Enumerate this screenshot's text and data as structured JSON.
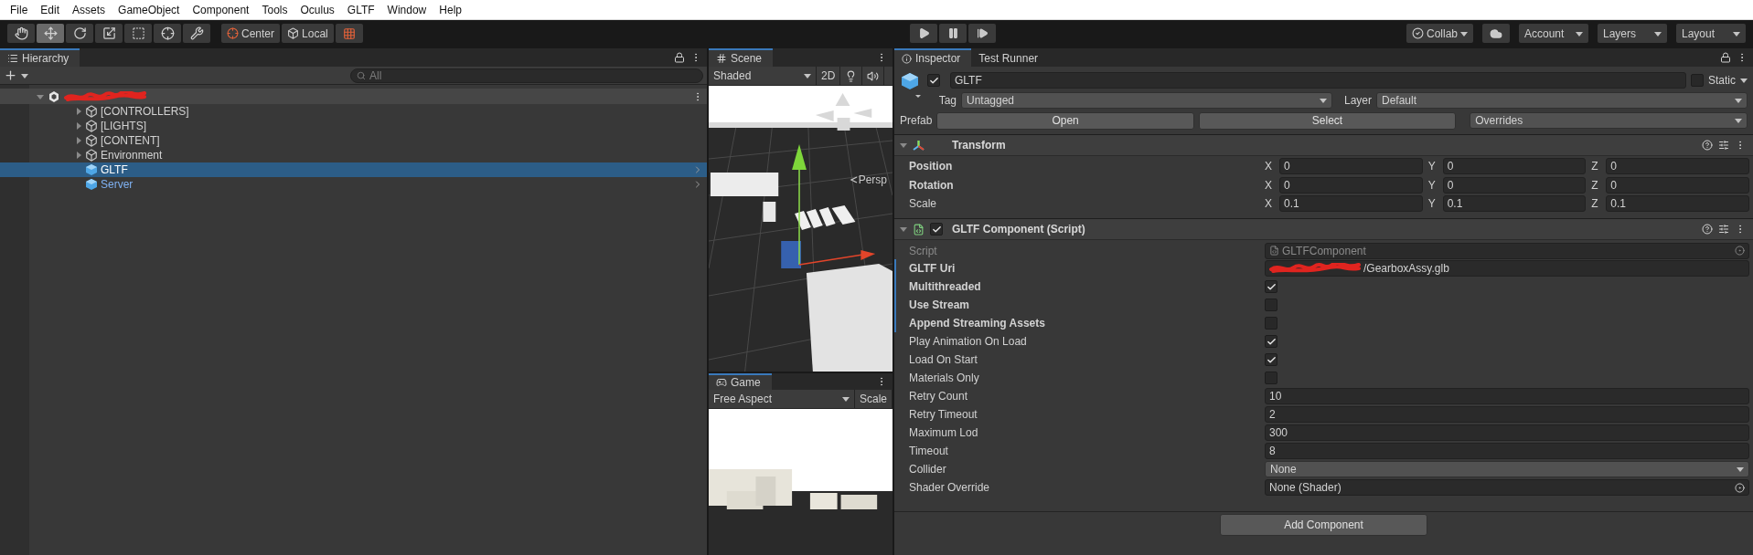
{
  "menu": [
    "File",
    "Edit",
    "Assets",
    "GameObject",
    "Component",
    "Tools",
    "Oculus",
    "GLTF",
    "Window",
    "Help"
  ],
  "toolbar": {
    "tools": [
      {
        "kind": "hand",
        "selected": false
      },
      {
        "kind": "move",
        "selected": true
      },
      {
        "kind": "rotate",
        "selected": false
      },
      {
        "kind": "scale",
        "selected": false
      },
      {
        "kind": "rect",
        "selected": false
      },
      {
        "kind": "transform",
        "selected": false
      },
      {
        "kind": "custom",
        "selected": false
      }
    ],
    "pivot": "Center",
    "space": "Local",
    "playback": [
      {
        "kind": "play"
      },
      {
        "kind": "pause"
      },
      {
        "kind": "step"
      }
    ],
    "collab": "Collab",
    "dropdowns": [
      "Account",
      "Layers",
      "Layout"
    ]
  },
  "hierarchy": {
    "title": "Hierarchy",
    "search_placeholder": "All",
    "scene_expanded": true,
    "items": [
      {
        "name": "[CONTROLLERS]",
        "kind": "object",
        "expandable": true,
        "selected": false
      },
      {
        "name": "[LIGHTS]",
        "kind": "object",
        "expandable": true,
        "selected": false
      },
      {
        "name": "[CONTENT]",
        "kind": "object",
        "expandable": true,
        "selected": false
      },
      {
        "name": "Environment",
        "kind": "object",
        "expandable": true,
        "selected": false
      },
      {
        "name": "GLTF",
        "kind": "prefab",
        "expandable": false,
        "selected": true
      },
      {
        "name": "Server",
        "kind": "prefab",
        "expandable": false,
        "selected": false
      }
    ]
  },
  "scene": {
    "title": "Scene",
    "shading": "Shaded",
    "mode_2d": "2D",
    "projection": "Persp"
  },
  "game": {
    "title": "Game",
    "aspect": "Free Aspect",
    "scale": "Scale"
  },
  "inspector": {
    "tabs": [
      {
        "label": "Inspector",
        "selected": true
      },
      {
        "label": "Test Runner",
        "selected": false
      }
    ],
    "object": {
      "name": "GLTF",
      "active": true,
      "static": false,
      "static_label": "Static",
      "tag_label": "Tag",
      "tag": "Untagged",
      "layer_label": "Layer",
      "layer": "Default",
      "prefab_label": "Prefab",
      "prefab_buttons": [
        "Open",
        "Select"
      ],
      "overrides": "Overrides"
    },
    "transform": {
      "title": "Transform",
      "expanded": true,
      "rows": [
        {
          "label": "Position",
          "overridden": true,
          "values": [
            {
              "axis": "X",
              "value": "0"
            },
            {
              "axis": "Y",
              "value": "0"
            },
            {
              "axis": "Z",
              "value": "0"
            }
          ]
        },
        {
          "label": "Rotation",
          "overridden": true,
          "values": [
            {
              "axis": "X",
              "value": "0"
            },
            {
              "axis": "Y",
              "value": "0"
            },
            {
              "axis": "Z",
              "value": "0"
            }
          ]
        },
        {
          "label": "Scale",
          "overridden": false,
          "values": [
            {
              "axis": "X",
              "value": "0.1"
            },
            {
              "axis": "Y",
              "value": "0.1"
            },
            {
              "axis": "Z",
              "value": "0.1"
            }
          ]
        }
      ]
    },
    "component": {
      "title": "GLTF Component (Script)",
      "enabled": true,
      "expanded": true,
      "fields": [
        {
          "kind": "script",
          "label": "Script",
          "value": "GLTFComponent",
          "overridden": false
        },
        {
          "kind": "uri",
          "label": "GLTF Uri",
          "value": "/GearboxAssy.glb",
          "overridden": true
        },
        {
          "kind": "toggle",
          "label": "Multithreaded",
          "checked": true,
          "overridden": true
        },
        {
          "kind": "toggle",
          "label": "Use Stream",
          "checked": false,
          "overridden": true
        },
        {
          "kind": "toggle",
          "label": "Append Streaming Assets",
          "checked": false,
          "overridden": true
        },
        {
          "kind": "toggle",
          "label": "Play Animation On Load",
          "checked": true,
          "overridden": false
        },
        {
          "kind": "toggle",
          "label": "Load On Start",
          "checked": true,
          "overridden": false
        },
        {
          "kind": "toggle",
          "label": "Materials Only",
          "checked": false,
          "overridden": false
        },
        {
          "kind": "number",
          "label": "Retry Count",
          "value": "10",
          "overridden": false
        },
        {
          "kind": "number",
          "label": "Retry Timeout",
          "value": "2",
          "overridden": false
        },
        {
          "kind": "number",
          "label": "Maximum Lod",
          "value": "300",
          "overridden": false
        },
        {
          "kind": "number",
          "label": "Timeout",
          "value": "8",
          "overridden": false
        },
        {
          "kind": "enum",
          "label": "Collider",
          "value": "None",
          "overridden": false
        },
        {
          "kind": "object",
          "label": "Shader Override",
          "value": "None (Shader)",
          "overridden": false
        }
      ]
    },
    "add_component": "Add Component"
  }
}
